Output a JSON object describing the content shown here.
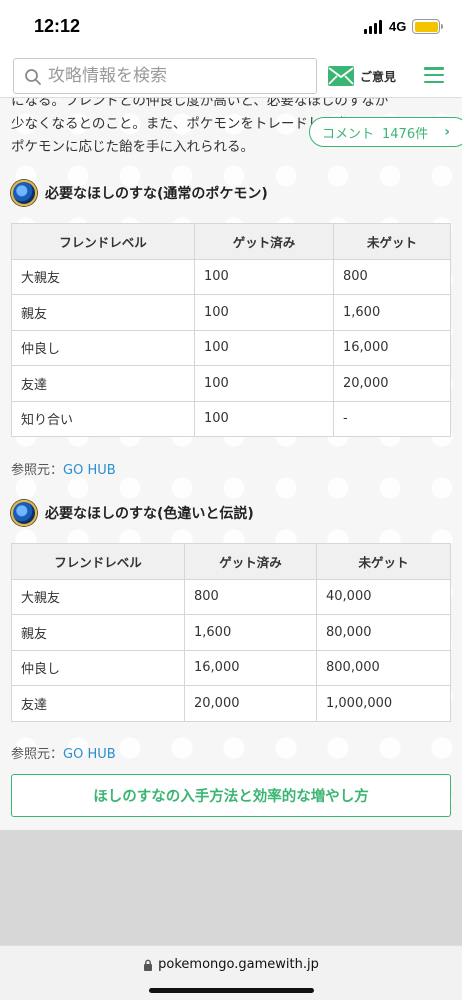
{
  "status_bar": {
    "time": "12:12",
    "network": "4G"
  },
  "header": {
    "search_placeholder": "攻略情報を検索",
    "feedback_label": "ご意見"
  },
  "intro_lines": [
    "になる。フレンドとの仲良し度が高いと、必要なほしのすなが",
    "少なくなるとのこと。また、ポケモンをトレードした際は、",
    "ポケモンに応じた飴を手に入れられる。"
  ],
  "comment_button": {
    "label": "コメント",
    "count": "1476件"
  },
  "section1": {
    "title": "必要なほしのすな(通常のポケモン)",
    "headers": [
      "フレンドレベル",
      "ゲット済み",
      "未ゲット"
    ],
    "rows": [
      [
        "大親友",
        "100",
        "800"
      ],
      [
        "親友",
        "100",
        "1,600"
      ],
      [
        "仲良し",
        "100",
        "16,000"
      ],
      [
        "友達",
        "100",
        "20,000"
      ],
      [
        "知り合い",
        "100",
        "-"
      ]
    ],
    "ref_label": "参照元：",
    "ref_link": "GO HUB"
  },
  "section2": {
    "title": "必要なほしのすな(色違いと伝説)",
    "headers": [
      "フレンドレベル",
      "ゲット済み",
      "未ゲット"
    ],
    "rows": [
      [
        "大親友",
        "800",
        "40,000"
      ],
      [
        "親友",
        "1,600",
        "80,000"
      ],
      [
        "仲良し",
        "16,000",
        "800,000"
      ],
      [
        "友達",
        "20,000",
        "1,000,000"
      ]
    ],
    "ref_label": "参照元：",
    "ref_link": "GO HUB"
  },
  "guide_button": "ほしのすなの入手方法と効率的な増やし方",
  "browser": {
    "url": "pokemongo.gamewith.jp"
  },
  "colors": {
    "accent": "#3bb573",
    "link": "#2a8fd0"
  }
}
